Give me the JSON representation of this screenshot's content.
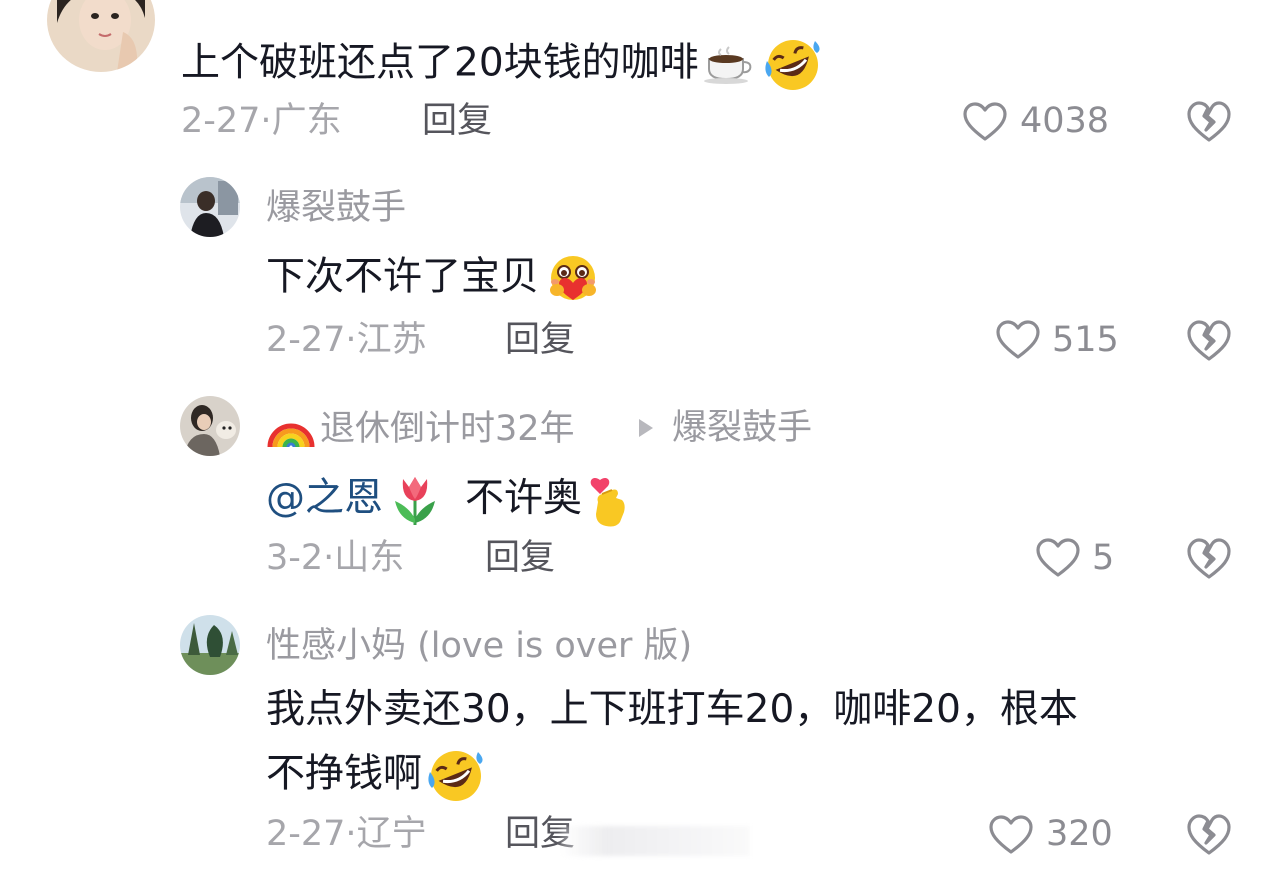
{
  "comments": [
    {
      "name": "",
      "text": "上个破班还点了20块钱的咖啡",
      "emojis": [
        "coffee-emoji",
        "rofl-emoji"
      ],
      "date": "2-27·",
      "location": "广东",
      "reply_label": "回复",
      "likes": "4038"
    },
    {
      "name": "爆裂鼓手",
      "text": "下次不许了宝贝",
      "emojis": [
        "hug-emoji"
      ],
      "date": "2-27·",
      "location": "江苏",
      "reply_label": "回复",
      "likes": "515"
    },
    {
      "name": "退休倒计时32年",
      "name_prefix_emoji": "rainbow-emoji",
      "reply_to": "爆裂鼓手",
      "mention": "@之恩",
      "text": "不许奥",
      "emojis": [
        "tulip-emoji",
        "finger-heart-emoji"
      ],
      "date": "3-2·",
      "location": "山东",
      "reply_label": "回复",
      "likes": "5"
    },
    {
      "name": "性感小妈 (love is over 版)",
      "text_line1": "我点外卖还30，上下班打车20，咖啡20，根本",
      "text_line2": "不挣钱啊",
      "emojis": [
        "rofl-emoji"
      ],
      "date": "2-27·",
      "location": "辽宁",
      "reply_label": "回复",
      "likes": "320"
    }
  ],
  "colors": {
    "text": "#161823",
    "meta": "#a6a6ab",
    "mention": "#1f4f80"
  }
}
